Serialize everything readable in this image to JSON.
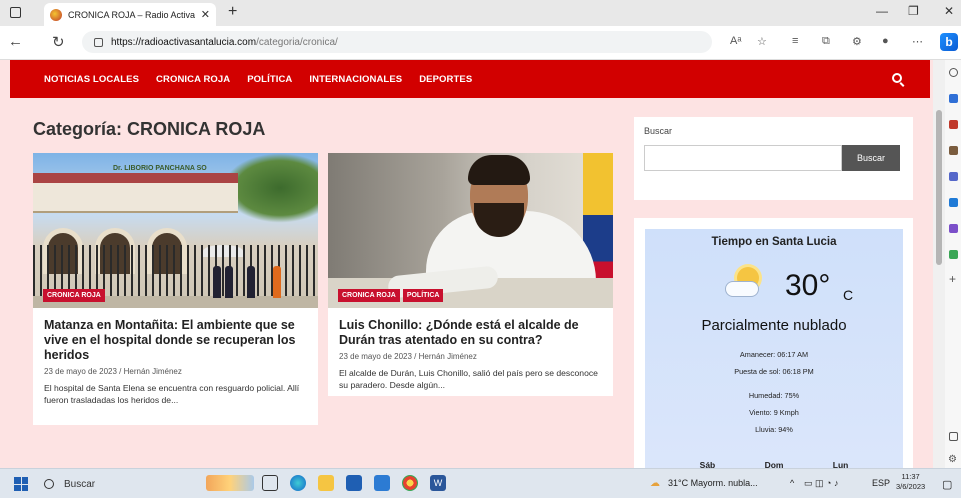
{
  "browser": {
    "tab_title": "CRONICA ROJA – Radio Activa S",
    "url_host": "https://radioactivasantalucia.com",
    "url_path": "/categoria/cronica/",
    "reader_label": "Aᵃ"
  },
  "nav": {
    "items": [
      "NOTICIAS LOCALES",
      "CRONICA ROJA",
      "POLÍTICA",
      "INTERNACIONALES",
      "DEPORTES"
    ]
  },
  "page": {
    "category_title": "Categoría: CRONICA ROJA"
  },
  "articles": [
    {
      "badges": [
        "CRONICA ROJA"
      ],
      "image_sign": "Dr. LIBORIO PANCHANA SO",
      "title": "Matanza en Montañita: El ambiente que se vive en el hospital donde se recuperan los heridos",
      "meta": "23 de mayo de 2023 / Hernán Jiménez",
      "excerpt": "El hospital de Santa Elena se encuentra con resguardo policial. Allí fueron trasladadas los heridos de..."
    },
    {
      "badges": [
        "CRONICA ROJA",
        "POLÍTICA"
      ],
      "title": "Luis Chonillo: ¿Dónde está el alcalde de Durán tras atentado en su contra?",
      "meta": "23 de mayo de 2023 / Hernán Jiménez",
      "excerpt": "El alcalde de Durán, Luis Chonillo, salió del país pero se desconoce su paradero. Desde algún..."
    }
  ],
  "sidebar": {
    "search_label": "Buscar",
    "search_button": "Buscar",
    "weather": {
      "title": "Tiempo en Santa Lucia",
      "temp": "30°",
      "unit": "C",
      "condition": "Parcialmente nublado",
      "sunrise": "Amanecer: 06:17 AM",
      "sunset": "Puesta de sol: 06:18 PM",
      "humidity": "Humedad: 75%",
      "wind": "Viento: 9 Kmph",
      "rain": "Lluvia: 94%",
      "days": [
        "Sáb",
        "Dom",
        "Lun"
      ]
    }
  },
  "taskbar": {
    "search": "Buscar",
    "weather": "31°C  Mayorm. nubla...",
    "lang": "ESP",
    "time": "11:37",
    "date": "3/6/2023"
  },
  "colors": {
    "nav_red": "#d20000",
    "badge_red": "#c8102e",
    "page_bg": "#fde3e3"
  }
}
